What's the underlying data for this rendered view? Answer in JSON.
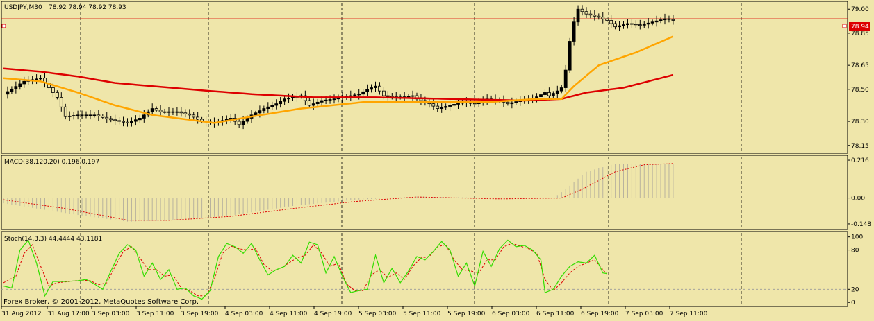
{
  "header": {
    "symbol": "USDJPY,M30",
    "ohlc": "78.92 78.94 78.92 78.93"
  },
  "price_tag": "78.94",
  "footer": {
    "copyright": "Forex Broker, © 2001-2012, MetaQuotes Software Corp."
  },
  "colors": {
    "background": "#EFE6AA",
    "candle": "#000000",
    "ma_fast": "#FFA500",
    "ma_slow": "#DD0000",
    "price_line": "#DD0000",
    "macd_hist": "#C9C2A8",
    "macd_signal": "#DD0000",
    "stoch_main": "#33DD00",
    "stoch_signal": "#DD0000",
    "grid": "#000000"
  },
  "chart_data": [
    {
      "type": "candlestick",
      "title": "USDJPY,M30",
      "y_ticks": [
        "79.00",
        "78.85",
        "78.65",
        "78.50",
        "78.30",
        "78.15"
      ],
      "ylim": [
        78.11,
        79.04
      ],
      "current_price": 78.94,
      "x_ticks": [
        "31 Aug 2012",
        "31 Aug 17:00",
        "3 Sep 03:00",
        "3 Sep 11:00",
        "3 Sep 19:00",
        "4 Sep 03:00",
        "4 Sep 11:00",
        "4 Sep 19:00",
        "5 Sep 03:00",
        "5 Sep 11:00",
        "5 Sep 19:00",
        "6 Sep 03:00",
        "6 Sep 11:00",
        "6 Sep 19:00",
        "7 Sep 03:00",
        "7 Sep 11:00"
      ],
      "close_path": [
        [
          0,
          78.47
        ],
        [
          5,
          78.55
        ],
        [
          9,
          78.57
        ],
        [
          13,
          78.45
        ],
        [
          14,
          78.39
        ],
        [
          15,
          78.33
        ],
        [
          18,
          78.34
        ],
        [
          22,
          78.34
        ],
        [
          26,
          78.31
        ],
        [
          30,
          78.29
        ],
        [
          33,
          78.32
        ],
        [
          36,
          78.38
        ],
        [
          38,
          78.36
        ],
        [
          42,
          78.36
        ],
        [
          45,
          78.34
        ],
        [
          48,
          78.3
        ],
        [
          51,
          78.29
        ],
        [
          55,
          78.32
        ],
        [
          57,
          78.28
        ],
        [
          60,
          78.34
        ],
        [
          63,
          78.38
        ],
        [
          66,
          78.41
        ],
        [
          68,
          78.44
        ],
        [
          72,
          78.46
        ],
        [
          74,
          78.4
        ],
        [
          77,
          78.43
        ],
        [
          80,
          78.44
        ],
        [
          84,
          78.46
        ],
        [
          86,
          78.47
        ],
        [
          88,
          78.5
        ],
        [
          90,
          78.52
        ],
        [
          92,
          78.46
        ],
        [
          96,
          78.45
        ],
        [
          99,
          78.46
        ],
        [
          100,
          78.44
        ],
        [
          103,
          78.41
        ],
        [
          105,
          78.38
        ],
        [
          108,
          78.4
        ],
        [
          111,
          78.42
        ],
        [
          114,
          78.41
        ],
        [
          117,
          78.44
        ],
        [
          120,
          78.43
        ],
        [
          122,
          78.41
        ],
        [
          125,
          78.43
        ],
        [
          128,
          78.44
        ],
        [
          131,
          78.48
        ],
        [
          132,
          78.46
        ],
        [
          134,
          78.49
        ],
        [
          135,
          78.51
        ],
        [
          136,
          78.62
        ],
        [
          137,
          78.8
        ],
        [
          138,
          78.92
        ],
        [
          139,
          79.0
        ],
        [
          141,
          78.97
        ],
        [
          144,
          78.95
        ],
        [
          146,
          78.93
        ],
        [
          148,
          78.89
        ],
        [
          151,
          78.91
        ],
        [
          154,
          78.9
        ],
        [
          157,
          78.92
        ],
        [
          160,
          78.94
        ],
        [
          162,
          78.93
        ]
      ],
      "ma_fast_path": [
        [
          0,
          78.57
        ],
        [
          9,
          78.55
        ],
        [
          18,
          78.48
        ],
        [
          27,
          78.4
        ],
        [
          36,
          78.34
        ],
        [
          45,
          78.31
        ],
        [
          51,
          78.29
        ],
        [
          60,
          78.33
        ],
        [
          72,
          78.38
        ],
        [
          87,
          78.42
        ],
        [
          102,
          78.42
        ],
        [
          117,
          78.42
        ],
        [
          129,
          78.44
        ],
        [
          135,
          78.44
        ],
        [
          138,
          78.52
        ],
        [
          144,
          78.65
        ],
        [
          153,
          78.73
        ],
        [
          162,
          78.83
        ]
      ],
      "ma_slow_path": [
        [
          0,
          78.63
        ],
        [
          9,
          78.61
        ],
        [
          18,
          78.58
        ],
        [
          27,
          78.54
        ],
        [
          36,
          78.52
        ],
        [
          45,
          78.5
        ],
        [
          60,
          78.47
        ],
        [
          75,
          78.45
        ],
        [
          90,
          78.45
        ],
        [
          108,
          78.44
        ],
        [
          126,
          78.43
        ],
        [
          135,
          78.44
        ],
        [
          141,
          78.48
        ],
        [
          150,
          78.51
        ],
        [
          162,
          78.59
        ]
      ]
    },
    {
      "type": "bar",
      "title": "MACD(38,120,20) 0.196 0.197",
      "y_ticks": [
        "0.216",
        "0.00",
        "-0.148"
      ],
      "ylim": [
        -0.172,
        0.236
      ],
      "hist_path": [
        [
          0,
          -0.03
        ],
        [
          18,
          -0.097
        ],
        [
          30,
          -0.135
        ],
        [
          40,
          -0.13
        ],
        [
          55,
          -0.1
        ],
        [
          70,
          -0.045
        ],
        [
          85,
          -0.01
        ],
        [
          100,
          0.008
        ],
        [
          120,
          0.0
        ],
        [
          133,
          0.0
        ],
        [
          136,
          0.05
        ],
        [
          141,
          0.15
        ],
        [
          148,
          0.196
        ],
        [
          162,
          0.196
        ]
      ],
      "signal_path": [
        [
          0,
          -0.01
        ],
        [
          15,
          -0.06
        ],
        [
          30,
          -0.127
        ],
        [
          40,
          -0.128
        ],
        [
          55,
          -0.105
        ],
        [
          70,
          -0.06
        ],
        [
          85,
          -0.02
        ],
        [
          100,
          0.006
        ],
        [
          120,
          -0.005
        ],
        [
          135,
          0.0
        ],
        [
          140,
          0.05
        ],
        [
          148,
          0.15
        ],
        [
          155,
          0.19
        ],
        [
          162,
          0.197
        ]
      ]
    },
    {
      "type": "line",
      "title": "Stoch(14,3,3) 44.4444 43.1181",
      "y_ticks": [
        "100",
        "80",
        "20",
        "0"
      ],
      "ylim": [
        -4,
        106
      ],
      "levels": [
        80,
        20
      ],
      "series": [
        {
          "name": "Stoch main",
          "path": [
            [
              0,
              25
            ],
            [
              2,
              22
            ],
            [
              4,
              80
            ],
            [
              6,
              95
            ],
            [
              8,
              60
            ],
            [
              10,
              10
            ],
            [
              12,
              32
            ],
            [
              15,
              32
            ],
            [
              18,
              33
            ],
            [
              20,
              35
            ],
            [
              22,
              28
            ],
            [
              24,
              20
            ],
            [
              26,
              48
            ],
            [
              28,
              75
            ],
            [
              30,
              88
            ],
            [
              32,
              80
            ],
            [
              34,
              40
            ],
            [
              36,
              60
            ],
            [
              38,
              35
            ],
            [
              40,
              50
            ],
            [
              42,
              20
            ],
            [
              44,
              22
            ],
            [
              46,
              10
            ],
            [
              48,
              5
            ],
            [
              50,
              18
            ],
            [
              52,
              70
            ],
            [
              54,
              90
            ],
            [
              56,
              85
            ],
            [
              58,
              75
            ],
            [
              60,
              90
            ],
            [
              62,
              65
            ],
            [
              64,
              42
            ],
            [
              66,
              50
            ],
            [
              68,
              55
            ],
            [
              70,
              72
            ],
            [
              72,
              60
            ],
            [
              74,
              92
            ],
            [
              76,
              88
            ],
            [
              78,
              45
            ],
            [
              80,
              70
            ],
            [
              82,
              40
            ],
            [
              84,
              15
            ],
            [
              86,
              18
            ],
            [
              88,
              20
            ],
            [
              90,
              72
            ],
            [
              92,
              30
            ],
            [
              94,
              52
            ],
            [
              96,
              30
            ],
            [
              98,
              48
            ],
            [
              100,
              70
            ],
            [
              102,
              65
            ],
            [
              104,
              78
            ],
            [
              106,
              93
            ],
            [
              108,
              80
            ],
            [
              110,
              40
            ],
            [
              112,
              60
            ],
            [
              114,
              25
            ],
            [
              116,
              78
            ],
            [
              118,
              55
            ],
            [
              120,
              82
            ],
            [
              122,
              95
            ],
            [
              124,
              85
            ],
            [
              126,
              87
            ],
            [
              128,
              80
            ],
            [
              130,
              65
            ],
            [
              131,
              15
            ],
            [
              133,
              20
            ],
            [
              135,
              40
            ],
            [
              137,
              55
            ],
            [
              139,
              62
            ],
            [
              141,
              60
            ],
            [
              143,
              72
            ],
            [
              145,
              45
            ],
            [
              146,
              44
            ]
          ]
        },
        {
          "name": "Stoch signal",
          "path": [
            [
              0,
              30
            ],
            [
              3,
              40
            ],
            [
              5,
              75
            ],
            [
              7,
              88
            ],
            [
              9,
              55
            ],
            [
              11,
              25
            ],
            [
              13,
              30
            ],
            [
              16,
              32
            ],
            [
              19,
              34
            ],
            [
              21,
              33
            ],
            [
              23,
              27
            ],
            [
              25,
              30
            ],
            [
              27,
              55
            ],
            [
              29,
              78
            ],
            [
              31,
              85
            ],
            [
              33,
              68
            ],
            [
              35,
              50
            ],
            [
              37,
              50
            ],
            [
              39,
              40
            ],
            [
              41,
              42
            ],
            [
              43,
              22
            ],
            [
              45,
              18
            ],
            [
              47,
              10
            ],
            [
              49,
              10
            ],
            [
              51,
              35
            ],
            [
              53,
              75
            ],
            [
              55,
              86
            ],
            [
              57,
              82
            ],
            [
              59,
              80
            ],
            [
              61,
              82
            ],
            [
              63,
              58
            ],
            [
              65,
              48
            ],
            [
              67,
              52
            ],
            [
              69,
              60
            ],
            [
              71,
              68
            ],
            [
              73,
              72
            ],
            [
              75,
              88
            ],
            [
              77,
              75
            ],
            [
              79,
              55
            ],
            [
              81,
              60
            ],
            [
              83,
              28
            ],
            [
              85,
              18
            ],
            [
              87,
              18
            ],
            [
              89,
              42
            ],
            [
              91,
              50
            ],
            [
              93,
              38
            ],
            [
              95,
              45
            ],
            [
              97,
              35
            ],
            [
              99,
              55
            ],
            [
              101,
              68
            ],
            [
              103,
              70
            ],
            [
              105,
              85
            ],
            [
              107,
              88
            ],
            [
              109,
              65
            ],
            [
              111,
              50
            ],
            [
              113,
              48
            ],
            [
              115,
              45
            ],
            [
              117,
              65
            ],
            [
              119,
              65
            ],
            [
              121,
              85
            ],
            [
              123,
              90
            ],
            [
              125,
              86
            ],
            [
              127,
              82
            ],
            [
              129,
              75
            ],
            [
              131,
              35
            ],
            [
              133,
              18
            ],
            [
              135,
              30
            ],
            [
              137,
              45
            ],
            [
              139,
              55
            ],
            [
              141,
              60
            ],
            [
              143,
              65
            ],
            [
              145,
              50
            ],
            [
              146,
              43
            ]
          ]
        }
      ]
    }
  ]
}
